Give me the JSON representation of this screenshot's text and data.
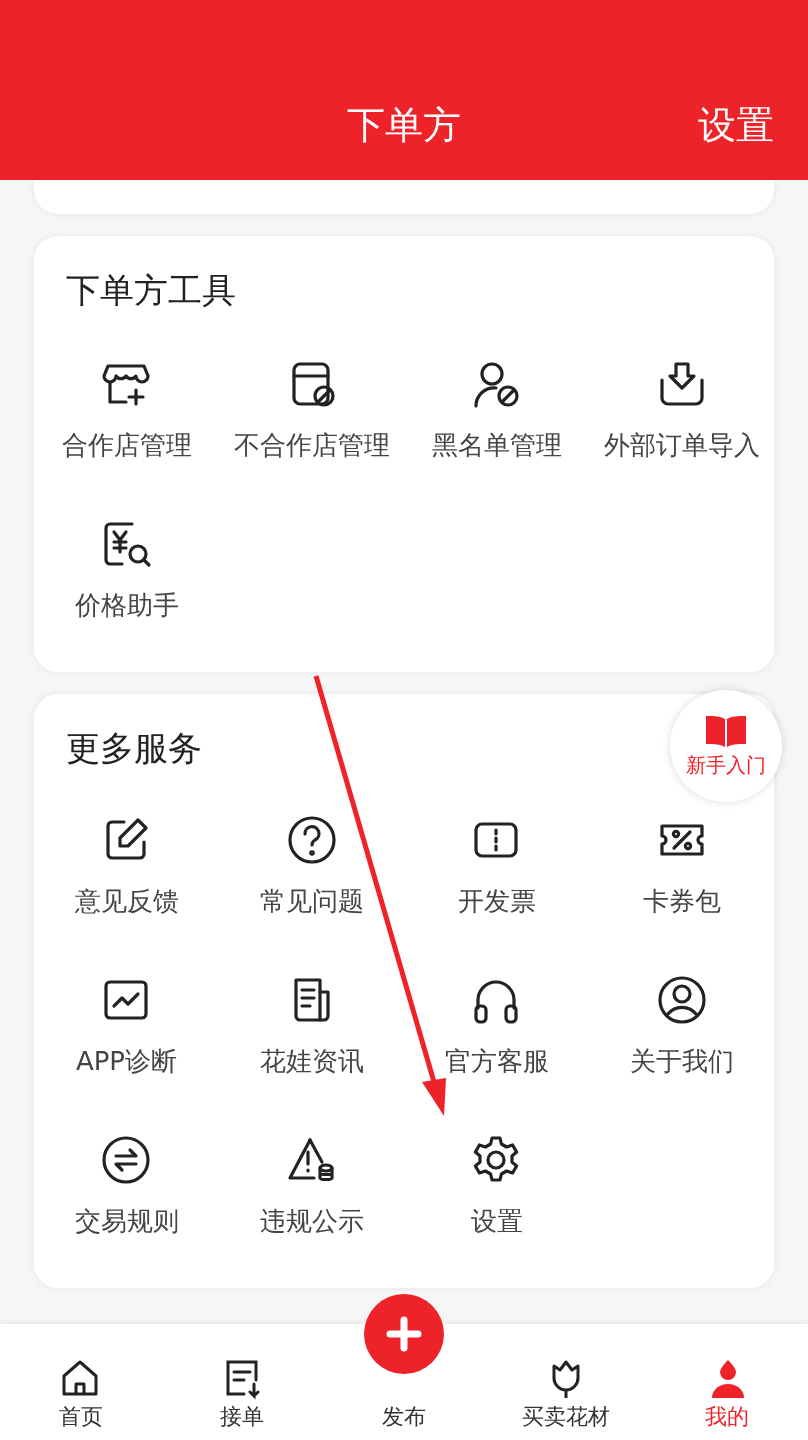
{
  "header": {
    "title": "下单方",
    "action": "设置"
  },
  "sections": [
    {
      "title": "下单方工具",
      "items": [
        {
          "label": "合作店管理"
        },
        {
          "label": "不合作店管理"
        },
        {
          "label": "黑名单管理"
        },
        {
          "label": "外部订单导入"
        },
        {
          "label": "价格助手"
        }
      ]
    },
    {
      "title": "更多服务",
      "items": [
        {
          "label": "意见反馈"
        },
        {
          "label": "常见问题"
        },
        {
          "label": "开发票"
        },
        {
          "label": "卡券包"
        },
        {
          "label": "APP诊断"
        },
        {
          "label": "花娃资讯"
        },
        {
          "label": "官方客服"
        },
        {
          "label": "关于我们"
        },
        {
          "label": "交易规则"
        },
        {
          "label": "违规公示"
        },
        {
          "label": "设置"
        }
      ]
    }
  ],
  "floating_badge": {
    "label": "新手入门"
  },
  "tabbar": [
    {
      "label": "首页",
      "selected": false,
      "kind": "tab"
    },
    {
      "label": "接单",
      "selected": false,
      "kind": "tab"
    },
    {
      "label": "发布",
      "selected": false,
      "kind": "publish"
    },
    {
      "label": "买卖花材",
      "selected": false,
      "kind": "tab"
    },
    {
      "label": "我的",
      "selected": true,
      "kind": "tab"
    }
  ]
}
